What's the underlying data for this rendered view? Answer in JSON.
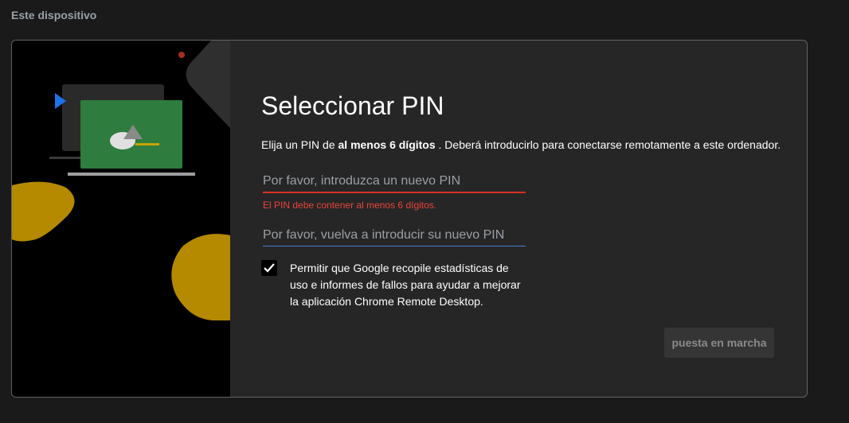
{
  "section": {
    "title": "Este dispositivo"
  },
  "dialog": {
    "title": "Seleccionar PIN",
    "description": {
      "prefix": "Elija un PIN de ",
      "bold": "al menos 6 dígitos",
      "suffix": " . Deberá introducirlo para conectarse remotamente a este ordenador."
    },
    "pin_field": {
      "placeholder": "Por favor, introduzca un nuevo PIN",
      "value": ""
    },
    "pin_error": "El PIN debe contener al menos 6 dígitos.",
    "confirm_field": {
      "placeholder": "Por favor, vuelva a introducir su nuevo PIN",
      "value": ""
    },
    "consent": {
      "checked": true,
      "label": "Permitir que Google recopile estadísticas de uso e informes de fallos para ayudar a mejorar la aplicación Chrome Remote Desktop."
    },
    "start_button": {
      "label": "puesta en marcha",
      "enabled": false
    }
  },
  "colors": {
    "background": "#1a1a1a",
    "panel": "#262626",
    "error": "#d93025",
    "focus": "#4a7fd4",
    "illustration_yellow": "#b58900",
    "illustration_green": "#2e7d3e",
    "illustration_blue": "#1a73e8",
    "illustration_red": "#a52a1f"
  },
  "icons": [
    "check-icon",
    "play-triangle-icon"
  ]
}
